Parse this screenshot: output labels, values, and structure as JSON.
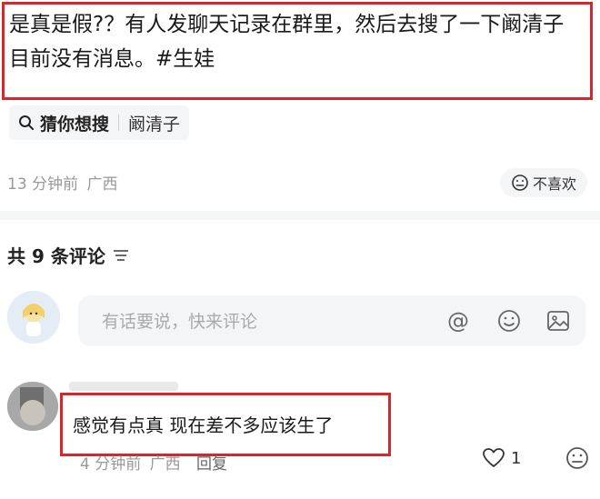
{
  "post": {
    "text": "是真是假?？有人发聊天记录在群里，然后去搜了一下阚清子目前没有消息。#生娃"
  },
  "search_tag": {
    "label": "猜你想搜",
    "keyword": "阚清子"
  },
  "post_meta": {
    "time": "13 分钟前",
    "location": "广西"
  },
  "dislike": {
    "label": "不喜欢"
  },
  "comments": {
    "title": "共 9 条评论",
    "sort_icon": "sort-lines-icon",
    "input_placeholder": "有话要说，快来评论",
    "input_icons": [
      "at-icon",
      "emoji-icon",
      "image-icon"
    ],
    "items": [
      {
        "text": "感觉有点真 现在差不多应该生了",
        "time": "4 分钟前",
        "location": "广西",
        "reply_label": "回复",
        "likes": "1"
      }
    ]
  },
  "colors": {
    "highlight_box": "#d9262b",
    "muted_text": "#999999",
    "surface": "#f4f5f7"
  }
}
